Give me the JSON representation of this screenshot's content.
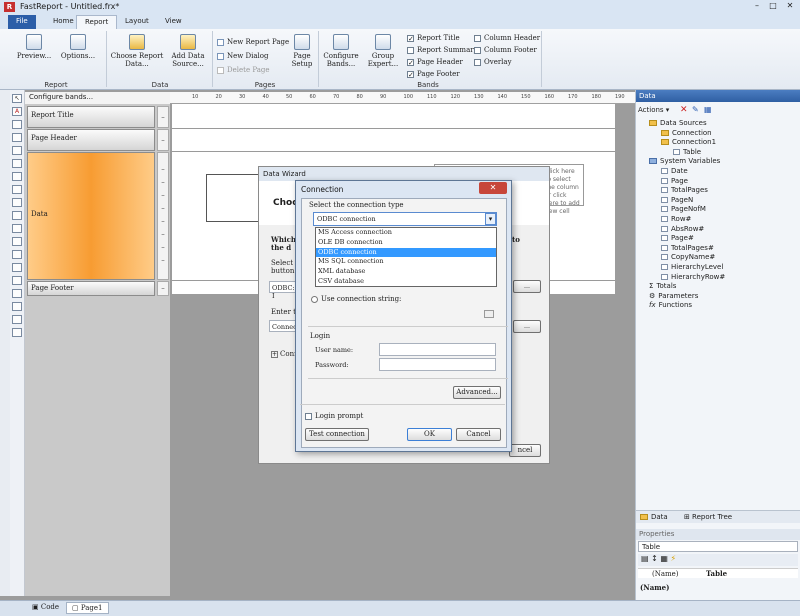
{
  "window": {
    "title": "FastReport - Untitled.frx*"
  },
  "tabs": [
    "File",
    "Home",
    "Report",
    "Layout",
    "View"
  ],
  "ribbon": {
    "report_group": {
      "label": "Report",
      "preview": "Preview...",
      "options": "Options..."
    },
    "data_group": {
      "label": "Data",
      "choose": "Choose Report Data...",
      "add": "Add Data Source..."
    },
    "pages_group": {
      "label": "Pages",
      "new_page": "New Report Page",
      "new_dialog": "New Dialog",
      "delete_page": "Delete Page",
      "page_setup": "Page Setup"
    },
    "bands_group": {
      "label": "Bands",
      "configure": "Configure Bands...",
      "group_expert": "Group Expert...",
      "opts": [
        {
          "label": "Report Title",
          "on": true
        },
        {
          "label": "Report Summary",
          "on": false
        },
        {
          "label": "Page Header",
          "on": true
        },
        {
          "label": "Page Footer",
          "on": true
        },
        {
          "label": "Column Header",
          "on": false
        },
        {
          "label": "Column Footer",
          "on": false
        },
        {
          "label": "Overlay",
          "on": false
        }
      ]
    }
  },
  "bands": {
    "configure": "Configure bands...",
    "report_title": "Report Title",
    "page_header": "Page Header",
    "data": "Data",
    "page_footer": "Page Footer"
  },
  "ruler": [
    "10",
    "20",
    "30",
    "40",
    "50",
    "60",
    "70",
    "80",
    "90",
    "100",
    "110",
    "120",
    "130",
    "140",
    "150",
    "160",
    "170",
    "180",
    "190"
  ],
  "right_panel": {
    "title": "Data",
    "actions": "Actions",
    "tree": [
      {
        "label": "Data Sources",
        "level": 0,
        "icon": "folder"
      },
      {
        "label": "Connection",
        "level": 1,
        "icon": "folder"
      },
      {
        "label": "Connection1",
        "level": 1,
        "icon": "folder"
      },
      {
        "label": "Table",
        "level": 2,
        "icon": "table"
      },
      {
        "label": "System Variables",
        "level": 0,
        "icon": "folder"
      },
      {
        "label": "Date",
        "level": 1,
        "icon": "var"
      },
      {
        "label": "Page",
        "level": 1,
        "icon": "var"
      },
      {
        "label": "TotalPages",
        "level": 1,
        "icon": "var"
      },
      {
        "label": "PageN",
        "level": 1,
        "icon": "var"
      },
      {
        "label": "PageNofM",
        "level": 1,
        "icon": "var"
      },
      {
        "label": "Row#",
        "level": 1,
        "icon": "var"
      },
      {
        "label": "AbsRow#",
        "level": 1,
        "icon": "var"
      },
      {
        "label": "Page#",
        "level": 1,
        "icon": "var"
      },
      {
        "label": "TotalPages#",
        "level": 1,
        "icon": "var"
      },
      {
        "label": "CopyName#",
        "level": 1,
        "icon": "var"
      },
      {
        "label": "HierarchyLevel",
        "level": 1,
        "icon": "var"
      },
      {
        "label": "HierarchyRow#",
        "level": 1,
        "icon": "var"
      },
      {
        "label": "Totals",
        "level": 0,
        "icon": "sum"
      },
      {
        "label": "Parameters",
        "level": 0,
        "icon": "param"
      },
      {
        "label": "Functions",
        "level": 0,
        "icon": "fx"
      }
    ],
    "tabs": {
      "data": "Data",
      "report_tree": "Report Tree"
    },
    "properties": {
      "title": "Properties",
      "object": "Table",
      "col_name": "(Name)",
      "col_value": "Table",
      "desc": "(Name)"
    }
  },
  "status": {
    "code": "Code",
    "page": "Page1"
  },
  "wizard": {
    "title": "Data Wizard",
    "heading": "Choo",
    "which": "Which",
    "the_d": "the d",
    "select": "Select",
    "button": "button",
    "odbc_field": "ODBC: I",
    "enter": "Enter t",
    "connect": "Connect",
    "conn_node": "Conn",
    "hint": "Click here to select the column or click here to add new cell",
    "new_btn": "New...",
    "cancel": "ncel",
    "to": "to"
  },
  "connection": {
    "title": "Connection",
    "select_type": "Select the connection type",
    "selected": "ODBC connection",
    "options": [
      "MS Access connection",
      "OLE DB connection",
      "ODBC connection",
      "MS SQL connection",
      "XML database",
      "CSV database"
    ],
    "use_string": "Use connection string:",
    "login": "Login",
    "user_name": "User name:",
    "password": "Password:",
    "advanced": "Advanced...",
    "login_prompt": "Login prompt",
    "test": "Test connection",
    "ok": "OK",
    "cancel": "Cancel"
  }
}
